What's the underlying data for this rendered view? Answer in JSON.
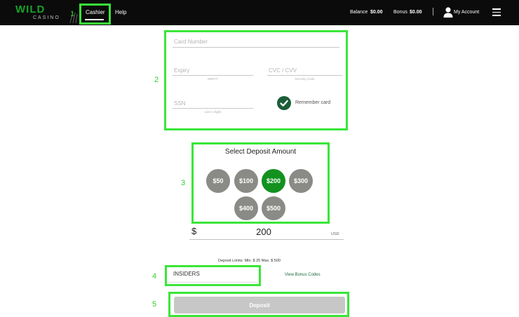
{
  "header": {
    "logo_text": "WILD",
    "logo_subtext": "CASINO",
    "nav": {
      "cashier": "Cashier",
      "help": "Help"
    },
    "balance_label": "Balance",
    "balance_value": "$0.00",
    "bonus_label": "Bonus",
    "bonus_value": "$0.00",
    "account_label": "My Account"
  },
  "annotations": [
    "1",
    "2",
    "3",
    "4",
    "5"
  ],
  "card_form": {
    "card_number_placeholder": "Card Number",
    "expiry_placeholder": "Expiry",
    "expiry_hint": "MM/YY",
    "cvc_placeholder": "CVC / CVV",
    "cvc_hint": "Security Code",
    "ssn_placeholder": "SSN",
    "ssn_hint": "Last 4 digits",
    "remember_label": "Remember card",
    "remember_checked": true
  },
  "deposit": {
    "title": "Select Deposit Amount",
    "amounts": [
      "$50",
      "$100",
      "$200",
      "$300",
      "$400",
      "$500"
    ],
    "selected": "$200",
    "currency_symbol": "$",
    "amount_value": "200",
    "currency_code": "USD",
    "limits_text": "Deposit Limits: Min. $ 25    Max. $ 500"
  },
  "bonus": {
    "code_value": "INSIDERS",
    "view_codes_label": "View Bonus Codes"
  },
  "submit": {
    "deposit_label": "Deposit"
  },
  "colors": {
    "highlight": "#39e639",
    "brand_green": "#17a22a",
    "selected_amount": "#13921f",
    "amount_default": "#8a8a87",
    "checkbox": "#1c5e39",
    "button_disabled": "#c7c7c7"
  }
}
